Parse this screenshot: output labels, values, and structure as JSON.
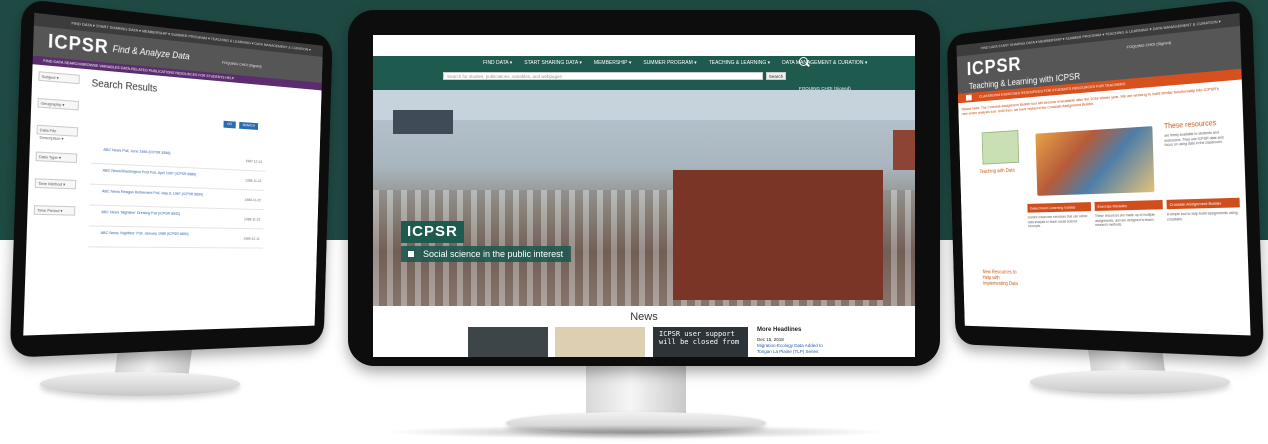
{
  "left_screen": {
    "top_nav": "FIND DATA ▾   START SHARING DATA ▾   MEMBERSHIP ▾   SUMMER PROGRAM ▾   TEACHING & LEARNING ▾   DATA MANAGEMENT & CURATION ▾",
    "logo": "ICPSR",
    "title": "Find & Analyze Data",
    "login": "FOQUING CHOI (Signed)",
    "subnav": "FIND DATA   SEARCH/BROWSE VARIABLES   DATA-RELATED PUBLICATIONS   RESOURCES FOR STUDENTS   HELP",
    "results_title": "Search Results",
    "sidebar": [
      "Subject ▾",
      "Geography ▾",
      "Data File Description ▾",
      "Data Type ▾",
      "Time Method ▾",
      "Time Period ▾"
    ],
    "buttons": [
      "GO",
      "SEARCH"
    ],
    "results": [
      {
        "link": "ABC News Poll, June 1986 (ICPSR 8388)",
        "date": "1987-12-14"
      },
      {
        "link": "ABC News/Washington Post Poll, April 1987 (ICPSR 8886)",
        "date": "1988-11-22"
      },
      {
        "link": "ABC News Reagan Retirement Poll, May 8, 1987 (ICPSR 8839)",
        "date": "1988-11-22"
      },
      {
        "link": "ABC News 'Nightline' Drinking Poll (ICPSR 8842)",
        "date": "1988-11-22"
      },
      {
        "link": "ABC News 'Nightline' Poll, January 1988 (ICPSR 8890)",
        "date": "1989-12-11"
      }
    ]
  },
  "center_screen": {
    "menu": [
      "FIND DATA ▾",
      "START SHARING DATA ▾",
      "MEMBERSHIP ▾",
      "SUMMER PROGRAM ▾",
      "TEACHING & LEARNING ▾",
      "DATA MANAGEMENT & CURATION ▾"
    ],
    "search_placeholder": "Search for studies, publications, variables, and webpages",
    "search_button": "Search",
    "login": "FOQUING CHOI (Signed)",
    "brand": "ICPSR",
    "tagline": "Social science in the public interest",
    "news_title": "News",
    "news_image_text": "ICPSR user support will be closed from",
    "more_headlines": "More Headlines",
    "headline_date": "Dec 15, 2018",
    "headline_text": "Migration-Ecology Data Added to Tongan La Plaine (TLP) Series"
  },
  "right_screen": {
    "top_nav": "FIND DATA   START SHARING DATA ▾   MEMBERSHIP ▾   SUMMER PROGRAM ▾   TEACHING & LEARNING ▾   DATA MANAGEMENT & CURATION ▾",
    "logo": "ICPSR",
    "title": "Teaching & Learning with ICPSR",
    "login": "FOQUING CHOI (Signed)",
    "subnav": "CLASSROOM EXERCISES   RESOURCES FOR STUDENTS   RESOURCES FOR TEACHERS",
    "notice": "Please Note: The Crosstab Assignment Builder tool will become unavailable after the 2018 Winter year. We are working to build similar functionality into ICPSR's new online analysis tool. Until then, we have replaced the Crosstab Assignment Builder.",
    "side_title": "These resources",
    "side_text": "are freely available to students and instructors. They use ICPSR data and focus on using data in the classroom.",
    "columns": [
      {
        "head": "Data-Driven Learning Guides",
        "text": "Guided classroom exercises that use online data analysis to teach social science concepts."
      },
      {
        "head": "Exercise Modules",
        "text": "These resources are made up of multiple assignments, and are designed to teach research methods."
      },
      {
        "head": "Crosstab Assignment Builder",
        "text": "A simple tool to help build assignments using crosstabs."
      }
    ],
    "left_links": [
      "Teaching with Data",
      "New Resources to Help with Implementing Data"
    ]
  }
}
